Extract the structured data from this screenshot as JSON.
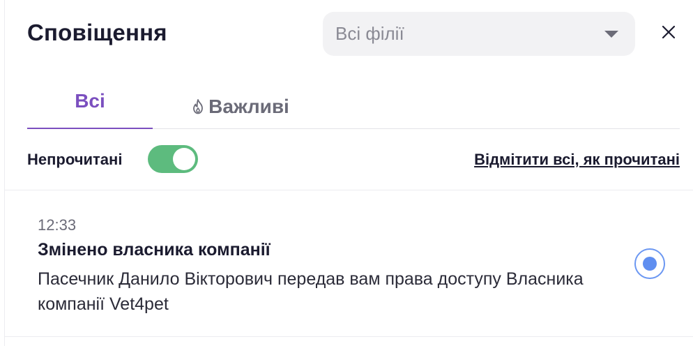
{
  "header": {
    "title": "Сповіщення",
    "branch_select": {
      "value": "Всі філії"
    },
    "close_icon": "close-icon"
  },
  "tabs": [
    {
      "label": "Всі",
      "active": true
    },
    {
      "label": "Важливі",
      "icon": "fire-icon",
      "active": false
    }
  ],
  "toolbar": {
    "unread_label": "Непрочитані",
    "unread_toggle_on": true,
    "mark_all_label": "Відмітити всі, як прочитані"
  },
  "notifications": [
    {
      "time": "12:33",
      "title": "Змінено власника компанії",
      "body": "Пасечник Данило Вікторович передав вам права доступу Власника компанії Vet4pet",
      "unread": true
    }
  ],
  "colors": {
    "accent": "#7b4fbf",
    "toggle_on": "#5dbb7e",
    "unread_dot": "#5f8ef0"
  }
}
